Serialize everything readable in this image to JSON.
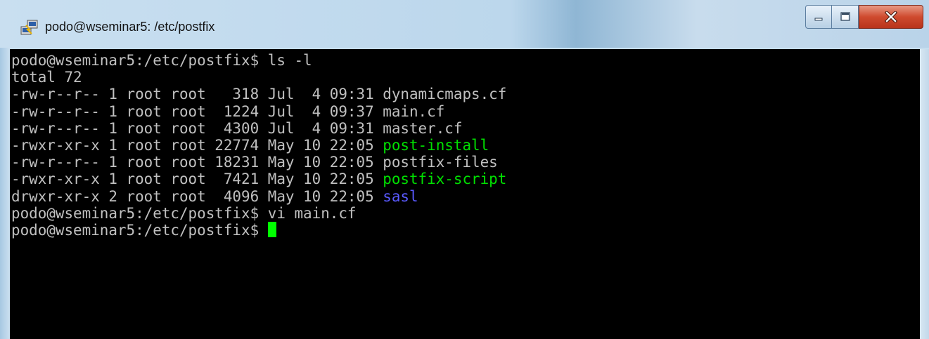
{
  "window": {
    "title": "podo@wseminar5: /etc/postfix",
    "icon": "putty-icon",
    "controls": {
      "minimize": "minimize-icon",
      "maximize": "maximize-icon",
      "close": "close-icon"
    }
  },
  "terminal": {
    "lines": [
      [
        {
          "t": "podo@wseminar5:/etc/postfix$ ls -l",
          "c": "#c0c0c0"
        }
      ],
      [
        {
          "t": "total 72",
          "c": "#c0c0c0"
        }
      ],
      [
        {
          "t": "-rw-r--r-- 1 root root   318 Jul  4 09:31 ",
          "c": "#c0c0c0"
        },
        {
          "t": "dynamicmaps.cf",
          "c": "#c0c0c0"
        }
      ],
      [
        {
          "t": "-rw-r--r-- 1 root root  1224 Jul  4 09:37 ",
          "c": "#c0c0c0"
        },
        {
          "t": "main.cf",
          "c": "#c0c0c0"
        }
      ],
      [
        {
          "t": "-rw-r--r-- 1 root root  4300 Jul  4 09:31 ",
          "c": "#c0c0c0"
        },
        {
          "t": "master.cf",
          "c": "#c0c0c0"
        }
      ],
      [
        {
          "t": "-rwxr-xr-x 1 root root 22774 May 10 22:05 ",
          "c": "#c0c0c0"
        },
        {
          "t": "post-install",
          "c": "#00e000"
        }
      ],
      [
        {
          "t": "-rw-r--r-- 1 root root 18231 May 10 22:05 ",
          "c": "#c0c0c0"
        },
        {
          "t": "postfix-files",
          "c": "#c0c0c0"
        }
      ],
      [
        {
          "t": "-rwxr-xr-x 1 root root  7421 May 10 22:05 ",
          "c": "#c0c0c0"
        },
        {
          "t": "postfix-script",
          "c": "#00e000"
        }
      ],
      [
        {
          "t": "drwxr-xr-x 2 root root  4096 May 10 22:05 ",
          "c": "#c0c0c0"
        },
        {
          "t": "sasl",
          "c": "#5a5aff"
        }
      ],
      [
        {
          "t": "podo@wseminar5:/etc/postfix$ vi main.cf",
          "c": "#c0c0c0"
        }
      ],
      [
        {
          "t": "podo@wseminar5:/etc/postfix$ ",
          "c": "#c0c0c0"
        }
      ]
    ],
    "cursor_color": "#00ff00",
    "background": "#000000"
  }
}
